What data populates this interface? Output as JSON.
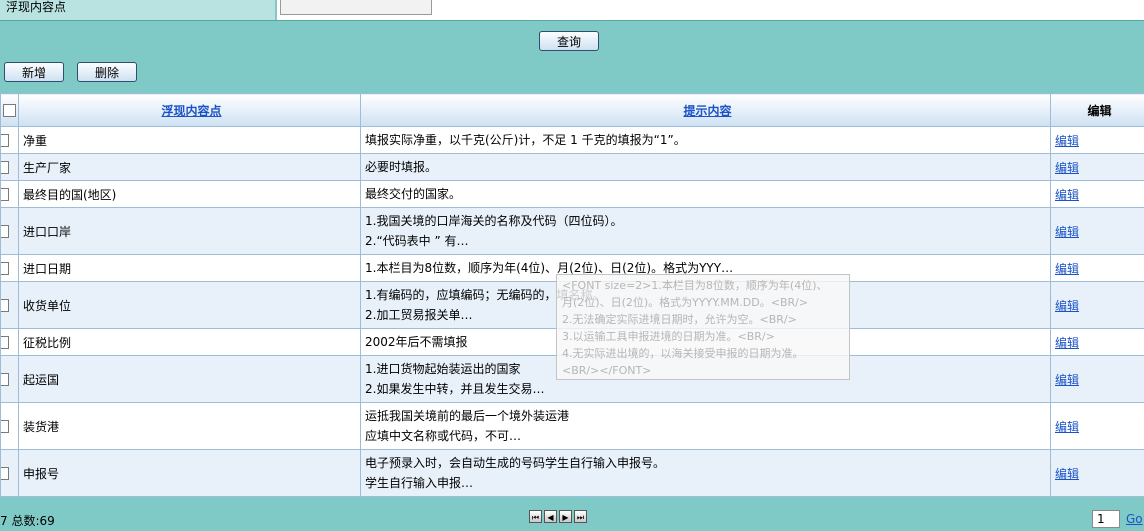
{
  "search": {
    "label": "浮现内容点",
    "input_value": ""
  },
  "buttons": {
    "query": "查询",
    "add": "新增",
    "delete": "删除"
  },
  "table": {
    "headers": {
      "field": "浮现内容点",
      "hint": "提示内容",
      "edit": "编辑"
    },
    "rows": [
      {
        "field": "净重",
        "hint1": "填报实际净重，以千克(公斤)计，不足 1 千克的填报为“1”。",
        "hint2": "",
        "edit": "编辑"
      },
      {
        "field": "生产厂家",
        "hint1": "必要时填报。",
        "hint2": "",
        "edit": "编辑"
      },
      {
        "field": "最终目的国(地区)",
        "hint1": "最终交付的国家。",
        "hint2": "",
        "edit": "编辑"
      },
      {
        "field": "进口口岸",
        "hint1": "1.我国关境的口岸海关的名称及代码（四位码）。",
        "hint2": "2.“代码表中 ” 有…",
        "edit": "编辑"
      },
      {
        "field": "进口日期",
        "hint1": "1.本栏目为8位数，顺序为年(4位)、月(2位)、日(2位)。格式为YYY…",
        "hint2": "",
        "edit": "编辑"
      },
      {
        "field": "收货单位",
        "hint1": "1.有编码的，应填编码；无编码的，填名称。",
        "hint2": "2.加工贸易报关单…",
        "edit": "编辑"
      },
      {
        "field": "征税比例",
        "hint1": "2002年后不需填报",
        "hint2": "",
        "edit": "编辑"
      },
      {
        "field": "起运国",
        "hint1": "1.进口货物起始装运出的国家",
        "hint2": "2.如果发生中转，并且发生交易…",
        "edit": "编辑"
      },
      {
        "field": "装货港",
        "hint1": "运抵我国关境前的最后一个境外装运港",
        "hint2": "应填中文名称或代码，不可…",
        "edit": "编辑"
      },
      {
        "field": "申报号",
        "hint1": "电子预录入时，会自动生成的号码学生自行输入申报号。",
        "hint2": "学生自行输入申报…",
        "edit": "编辑"
      }
    ]
  },
  "tooltip": {
    "lines": [
      "<FONT size=2>1.本栏目为8位数，顺序为年(4位)、",
      "月(2位)、日(2位)。格式为YYYY.MM.DD。<BR/>",
      "2.无法确定实际进境日期时，允许为空。<BR/>",
      "3.以运输工具申报进境的日期为准。<BR/>",
      "4.无实际进出境的，以海关接受申报的日期为准。",
      "<BR/></FONT>"
    ]
  },
  "footer": {
    "total": "7 总数:69",
    "page": "1",
    "go": "Go"
  }
}
